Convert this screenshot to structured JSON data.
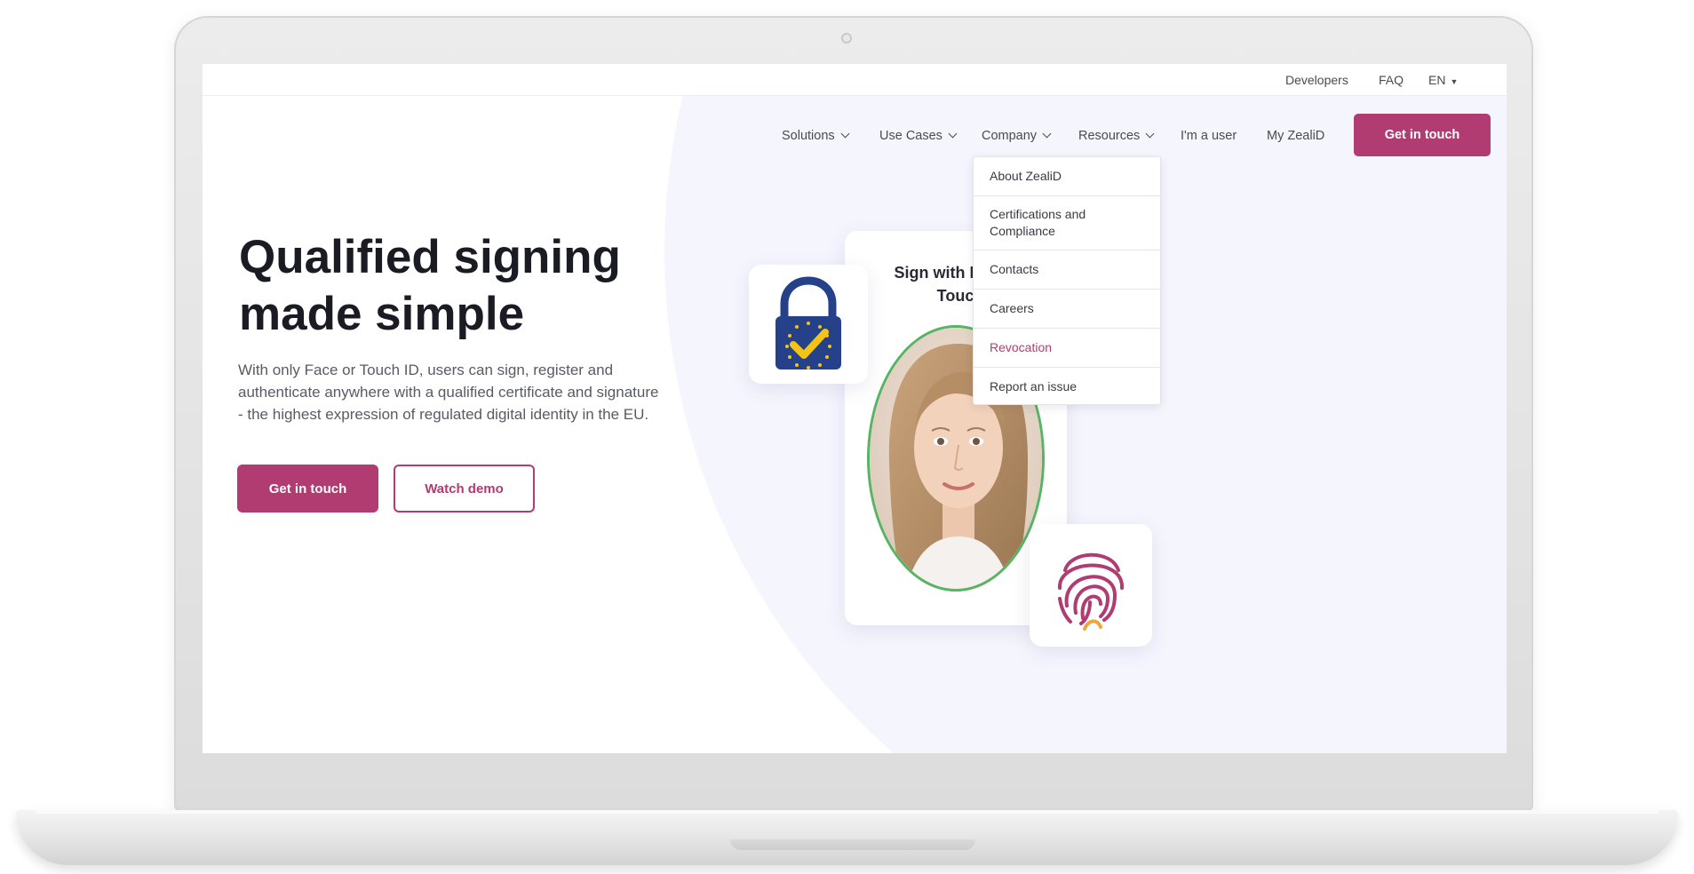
{
  "topbar": {
    "developers": "Developers",
    "faq": "FAQ",
    "language": "EN"
  },
  "nav": {
    "solutions": "Solutions",
    "use_cases": "Use Cases",
    "company": "Company",
    "resources": "Resources",
    "im_a_user": "I'm a user",
    "my_zealid": "My ZealiD",
    "cta": "Get in touch"
  },
  "company_menu": {
    "items": [
      {
        "label": "About ZealiD"
      },
      {
        "label": "Certifications and Compliance"
      },
      {
        "label": "Contacts"
      },
      {
        "label": "Careers"
      },
      {
        "label": "Revocation"
      },
      {
        "label": "Report an issue"
      }
    ]
  },
  "hero": {
    "title": "Qualified signing made simple",
    "subtitle": "With only Face or Touch ID, users can sign, register and authenticate anywhere with a qualified certificate and signature - the highest expression of regulated digital identity in the EU.",
    "primary_button": "Get in touch",
    "secondary_button": "Watch demo"
  },
  "illustration": {
    "phone_text": "Sign with Face or Touch"
  },
  "colors": {
    "brand": "#b03c72",
    "hero_bg": "#f5f5fe",
    "oval_border": "#56b463",
    "lock_blue": "#24418a",
    "check_yellow": "#f3c317"
  },
  "icons": [
    "eu-lock-icon",
    "fingerprint-icon",
    "chevron-down-icon",
    "caret-down-icon",
    "camera-icon"
  ]
}
